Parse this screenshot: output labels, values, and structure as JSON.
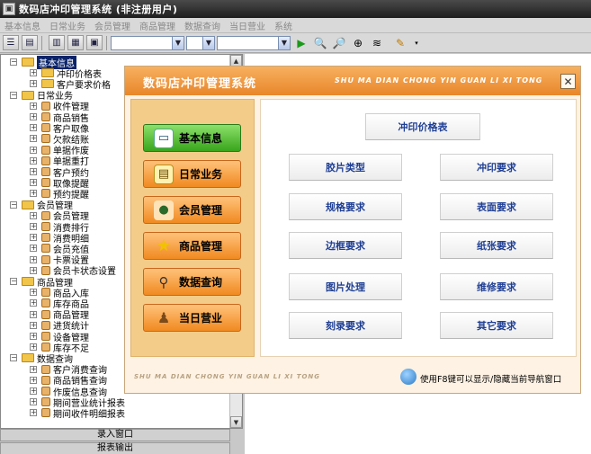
{
  "window": {
    "title": "数码店冲印管理系统 (非注册用户)"
  },
  "menubar": [
    "基本信息",
    "日常业务",
    "会员管理",
    "商品管理",
    "数据查询",
    "当日营业",
    "系统"
  ],
  "toolbar": {
    "combo1": "",
    "combo2": "",
    "combo3": ""
  },
  "tree": [
    {
      "label": "基本信息",
      "level": 0,
      "expanded": true,
      "folder": true,
      "selected": true
    },
    {
      "label": "冲印价格表",
      "level": 1,
      "folder": true
    },
    {
      "label": "客户要求价格",
      "level": 1,
      "folder": true
    },
    {
      "label": "日常业务",
      "level": 0,
      "expanded": true,
      "folder": true
    },
    {
      "label": "收件管理",
      "level": 1
    },
    {
      "label": "商品销售",
      "level": 1
    },
    {
      "label": "客户取像",
      "level": 1
    },
    {
      "label": "欠款结账",
      "level": 1
    },
    {
      "label": "单据作废",
      "level": 1
    },
    {
      "label": "单据重打",
      "level": 1
    },
    {
      "label": "客户预约",
      "level": 1
    },
    {
      "label": "取像提醒",
      "level": 1
    },
    {
      "label": "预约提醒",
      "level": 1
    },
    {
      "label": "会员管理",
      "level": 0,
      "expanded": true,
      "folder": true
    },
    {
      "label": "会员管理",
      "level": 1
    },
    {
      "label": "消费排行",
      "level": 1
    },
    {
      "label": "消费明细",
      "level": 1
    },
    {
      "label": "会员充值",
      "level": 1
    },
    {
      "label": "卡票设置",
      "level": 1
    },
    {
      "label": "会员卡状态设置",
      "level": 1
    },
    {
      "label": "商品管理",
      "level": 0,
      "expanded": true,
      "folder": true
    },
    {
      "label": "商品入库",
      "level": 1
    },
    {
      "label": "库存商品",
      "level": 1
    },
    {
      "label": "商品管理",
      "level": 1
    },
    {
      "label": "进货统计",
      "level": 1
    },
    {
      "label": "设备管理",
      "level": 1
    },
    {
      "label": "库存不足",
      "level": 1
    },
    {
      "label": "数据查询",
      "level": 0,
      "expanded": true,
      "folder": true
    },
    {
      "label": "客户消费查询",
      "level": 1
    },
    {
      "label": "商品销售查询",
      "level": 1
    },
    {
      "label": "作废信息查询",
      "level": 1
    },
    {
      "label": "期间营业统计报表",
      "level": 1
    },
    {
      "label": "期间收件明细报表",
      "level": 1
    }
  ],
  "bottom_buttons": {
    "input_window": "录入窗口",
    "report_output": "报表输出"
  },
  "dialog": {
    "title": "数码店冲印管理系统",
    "pinyin_header": "SHU MA DIAN CHONG YIN GUAN LI XI TONG",
    "pinyin_footer": "SHU MA DIAN CHONG YIN GUAN LI XI TONG",
    "tip": "使用F8键可以显示/隐藏当前导航窗口",
    "nav": [
      {
        "label": "基本信息",
        "icon": "id-card-icon",
        "active": true
      },
      {
        "label": "日常业务",
        "icon": "ledger-icon",
        "active": false
      },
      {
        "label": "会员管理",
        "icon": "members-icon",
        "active": false
      },
      {
        "label": "商品管理",
        "icon": "star-icon",
        "active": false
      },
      {
        "label": "数据查询",
        "icon": "magnifier-icon",
        "active": false
      },
      {
        "label": "当日营业",
        "icon": "person-icon",
        "active": false
      }
    ],
    "options": {
      "price_table": "冲印价格表",
      "film_type": "胶片类型",
      "print_req": "冲印要求",
      "spec_req": "规格要求",
      "surface_req": "表面要求",
      "border_req": "边框要求",
      "paper_req": "纸张要求",
      "image_proc": "图片处理",
      "repair_req": "维修要求",
      "burn_req": "刻录要求",
      "other_req": "其它要求"
    }
  }
}
